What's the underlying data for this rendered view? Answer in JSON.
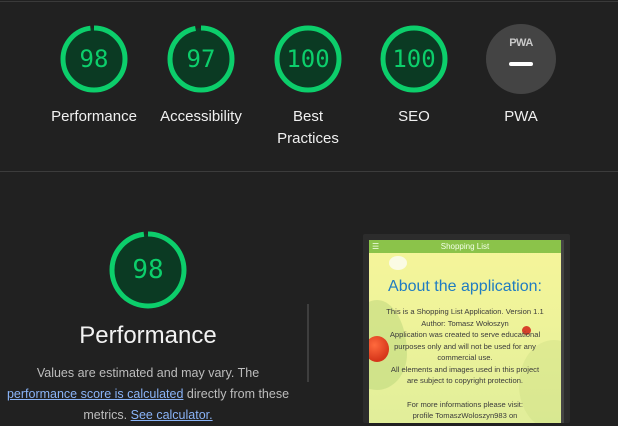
{
  "categories": [
    {
      "score": "98",
      "value": 98,
      "label": "Performance"
    },
    {
      "score": "97",
      "value": 97,
      "label": "Accessibility"
    },
    {
      "score": "100",
      "value": 100,
      "label": "Best Practices"
    },
    {
      "score": "100",
      "value": 100,
      "label": "SEO"
    }
  ],
  "pwa": {
    "badge_text": "PWA",
    "label": "PWA"
  },
  "performance": {
    "score": "98",
    "value": 98,
    "title": "Performance",
    "desc_part1": "Values are estimated and may vary. The",
    "desc_link1": "performance score is calculated",
    "desc_part2": " directly from these metrics. ",
    "desc_link2": "See calculator."
  },
  "screenshot": {
    "app_bar_title": "Shopping List",
    "heading": "About the application:",
    "lines": [
      "This is a Shopping List Application. Version 1.1",
      "Author: Tomasz Wołoszyn",
      "Application was created to serve educational",
      "purposes only and will not be used for any",
      "commercial use.",
      "All elements and images used in this project",
      "are subject to copyright protection."
    ],
    "lines2": [
      "For more informations please visit:",
      "profile TomaszWoloszyn983 on"
    ]
  },
  "colors": {
    "pass": "#0cce6b",
    "pass_bg": "#0b3a23",
    "background": "#212121",
    "link": "#8ab4f8"
  }
}
